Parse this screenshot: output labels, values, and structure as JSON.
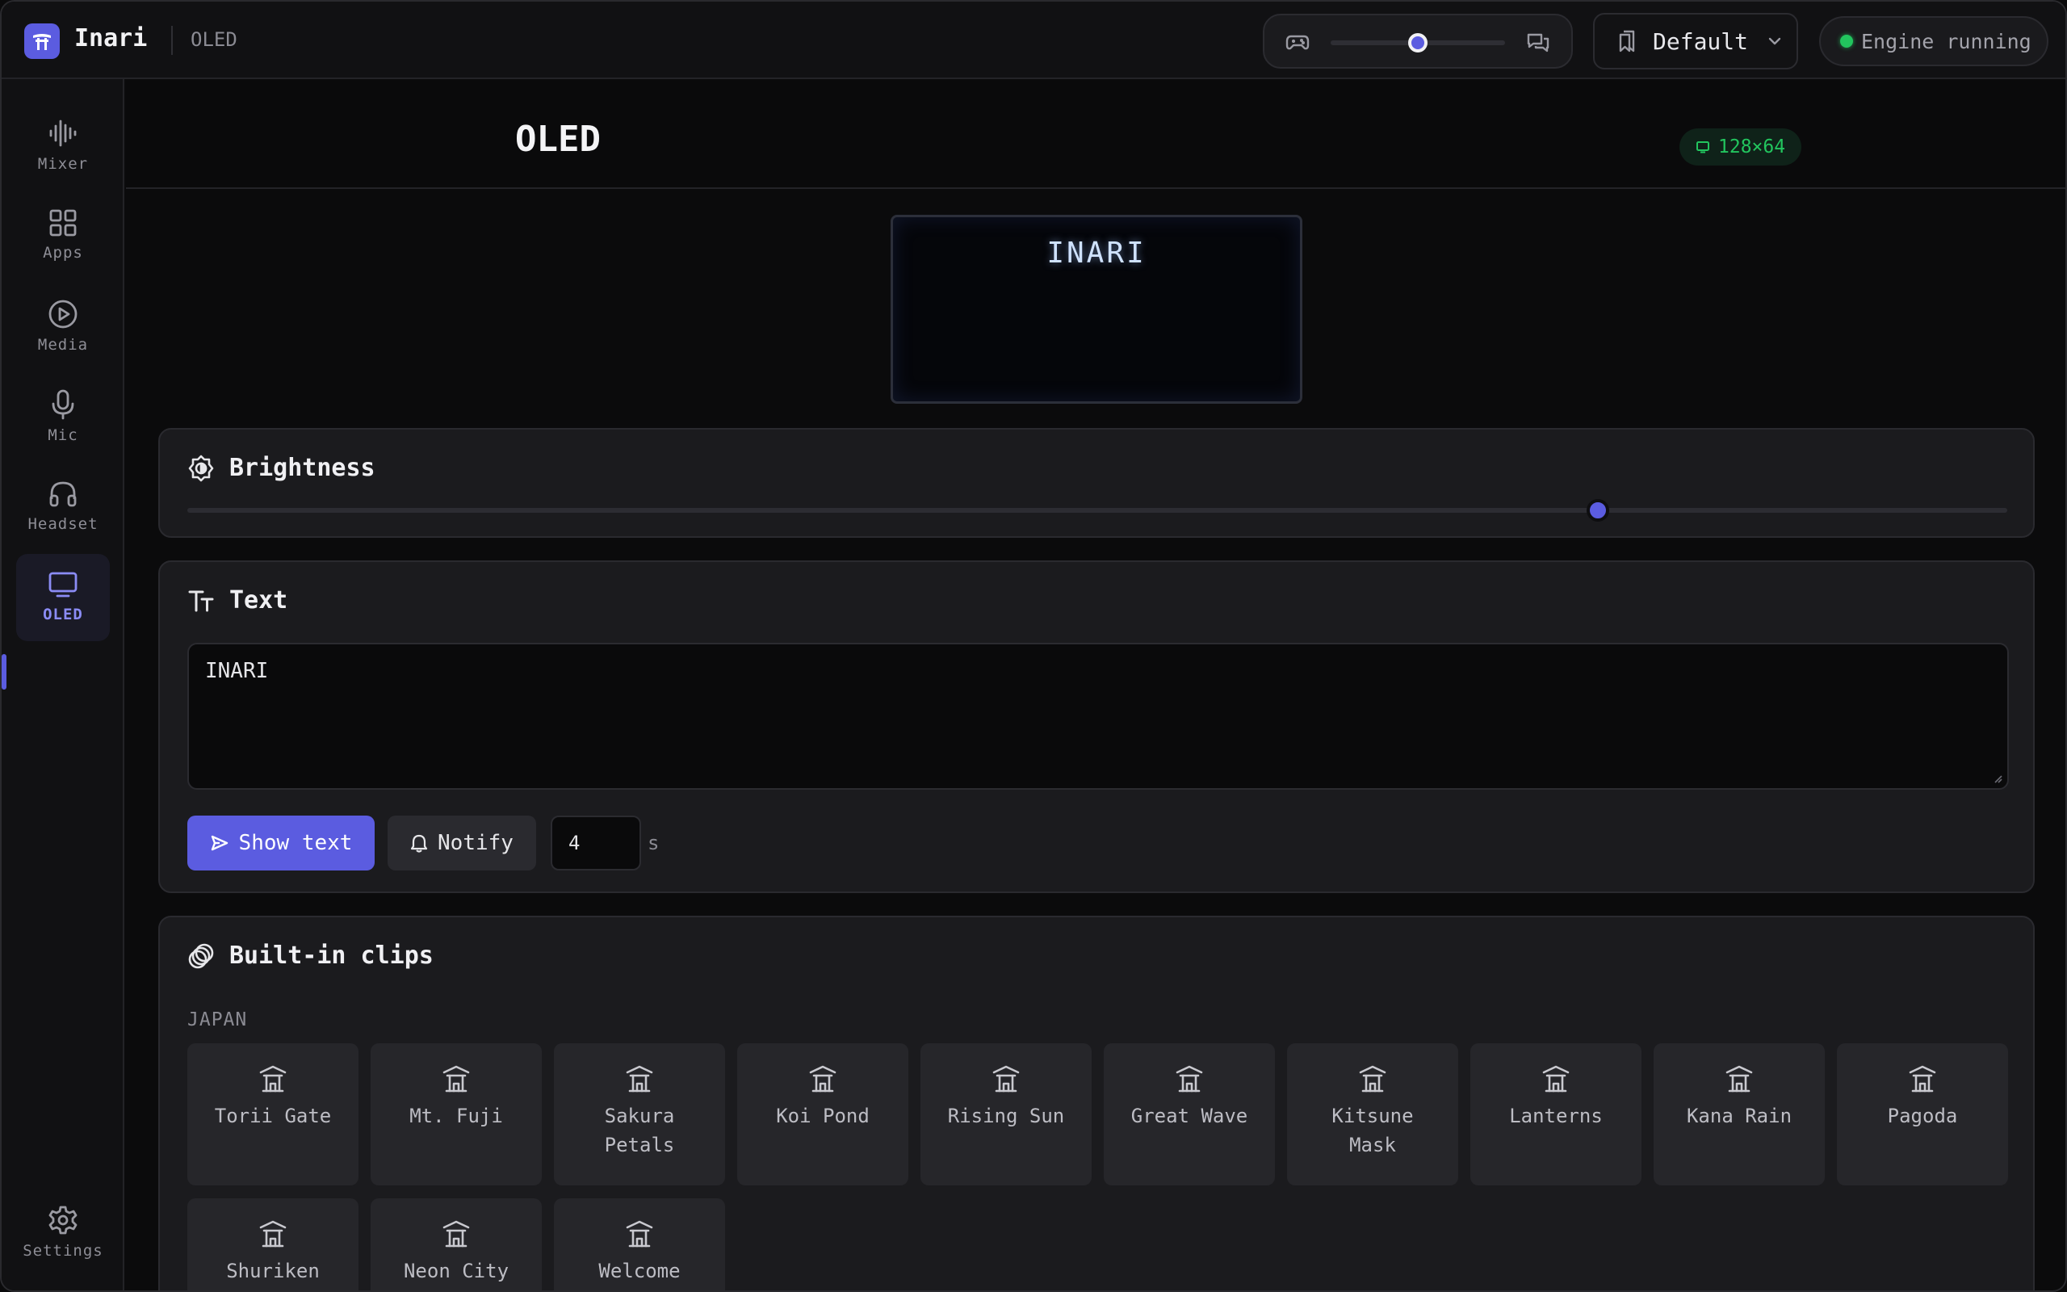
{
  "app": {
    "name": "Inari",
    "breadcrumb": "OLED"
  },
  "topbar": {
    "mode_slider": {
      "left_icon": "gamepad-icon",
      "right_icon": "chat-icon",
      "value": 0.5
    },
    "profile": {
      "label": "Default"
    },
    "engine_status": {
      "label": "Engine running",
      "color": "#22c55e"
    }
  },
  "sidebar": {
    "items": [
      {
        "label": "Mixer",
        "icon": "waveform-icon"
      },
      {
        "label": "Apps",
        "icon": "grid-icon"
      },
      {
        "label": "Media",
        "icon": "play-circle-icon"
      },
      {
        "label": "Mic",
        "icon": "microphone-icon"
      },
      {
        "label": "Headset",
        "icon": "headphones-icon"
      },
      {
        "label": "OLED",
        "icon": "monitor-icon",
        "active": true
      }
    ],
    "settings": {
      "label": "Settings",
      "icon": "gear-icon"
    }
  },
  "page": {
    "title": "OLED",
    "resolution_badge": "128×64"
  },
  "preview": {
    "text": "INARI"
  },
  "brightness": {
    "title": "Brightness",
    "value": 0.775
  },
  "text_card": {
    "title": "Text",
    "input_value": "INARI",
    "show_button": "Show text",
    "notify_button": "Notify",
    "duration_value": "4",
    "duration_unit": "s"
  },
  "clips": {
    "title": "Built-in clips",
    "group": "JAPAN",
    "items": [
      "Torii Gate",
      "Mt. Fuji",
      "Sakura Petals",
      "Koi Pond",
      "Rising Sun",
      "Great Wave",
      "Kitsune Mask",
      "Lanterns",
      "Kana Rain",
      "Pagoda",
      "Shuriken",
      "Neon City",
      "Welcome"
    ]
  },
  "colors": {
    "accent": "#5b5ce0",
    "success": "#22c55e",
    "background": "#0b0b0c",
    "card": "#1b1b1e"
  }
}
